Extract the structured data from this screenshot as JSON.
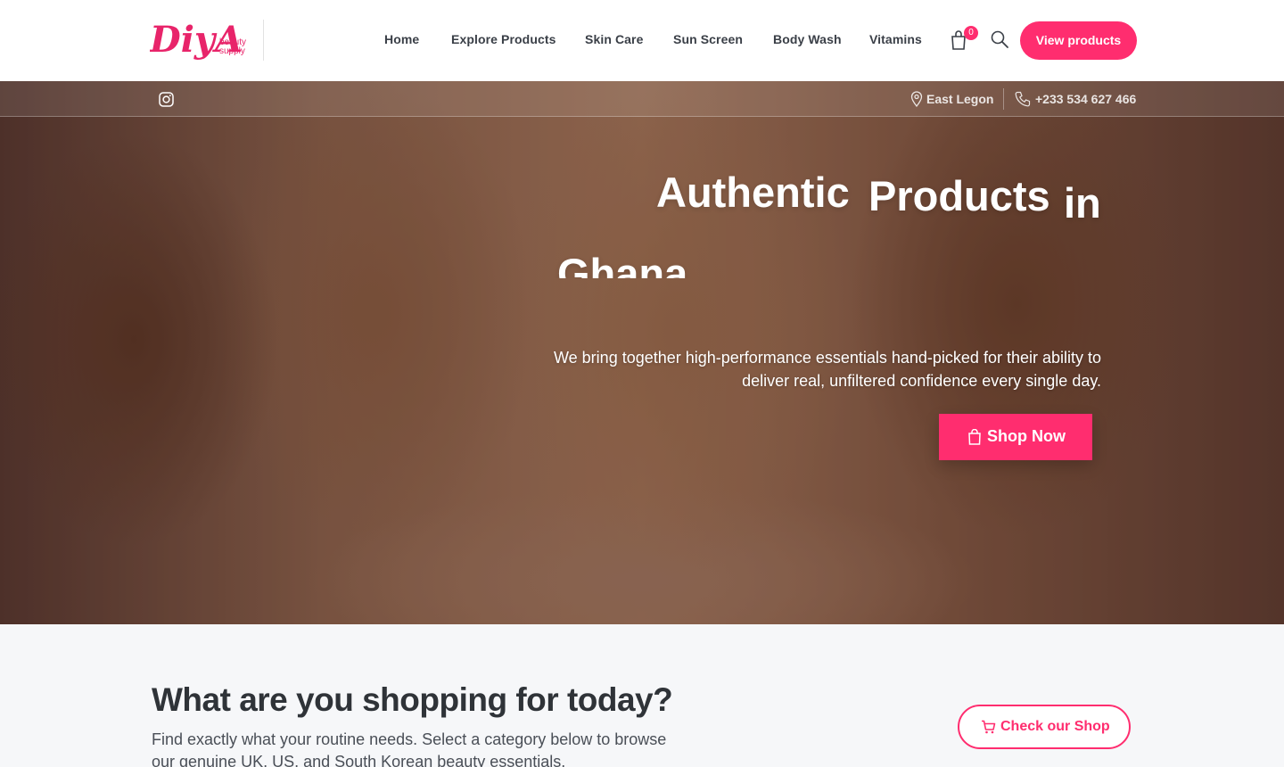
{
  "brand": {
    "logo_word": "DiyA",
    "logo_sub_1": "beauty",
    "logo_sub_2": "supply",
    "accent_color": "#ff2d6f"
  },
  "nav": {
    "items": [
      {
        "label": "Home"
      },
      {
        "label": "Explore Products"
      },
      {
        "label": "Skin Care"
      },
      {
        "label": "Sun Screen"
      },
      {
        "label": "Body Wash"
      },
      {
        "label": "Vitamins"
      }
    ],
    "cart_count": "0",
    "cta_label": "View products",
    "icons": [
      "cart-icon",
      "search-icon"
    ]
  },
  "topbar": {
    "social_icon": "instagram-icon",
    "location": "East Legon",
    "phone": "+233 534 627 466"
  },
  "hero": {
    "title_words": [
      "Authentic",
      "Products",
      "in",
      "Ghana"
    ],
    "subtitle_line_1": "We bring together high-performance essentials hand-picked for their ability to",
    "subtitle_line_2": "deliver real, unfiltered confidence every single day.",
    "cta_label": "Shop Now"
  },
  "section": {
    "title": "What are you shopping for today?",
    "description_line_1": "Find exactly what your routine needs. Select a category below to browse",
    "description_line_2": "our genuine UK, US, and South Korean beauty essentials.",
    "cta_label": "Check our Shop"
  }
}
